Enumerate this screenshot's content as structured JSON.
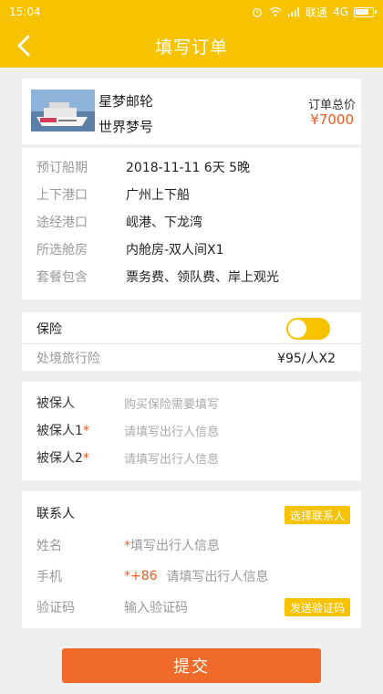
{
  "status_bar": {
    "time": "15:04",
    "carrier": "联通",
    "network": "4G"
  },
  "nav": {
    "title": "填写订单",
    "back_icon": "chevron-left-icon"
  },
  "product": {
    "name_line1": "星梦邮轮",
    "name_line2": "世界梦号",
    "total_label": "订单总价",
    "total_value": "¥7000"
  },
  "details": [
    {
      "label": "预订船期",
      "value": "2018-11-11  6天  5晚"
    },
    {
      "label": "上下港口",
      "value": "广州上下船"
    },
    {
      "label": "途经港口",
      "value": "岘港、下龙湾"
    },
    {
      "label": "所选舱房",
      "value": "内舱房-双人间X1"
    },
    {
      "label": "套餐包含",
      "value": "票务费、领队费、岸上观光"
    }
  ],
  "insurance": {
    "header": "保险",
    "toggle_on": true,
    "item": "处境旅行险",
    "price": "¥95/人X2"
  },
  "insured": {
    "header": "被保人",
    "header_hint": "购买保险需要填写",
    "persons": [
      {
        "label": "被保人1",
        "star": "*",
        "placeholder": "请填写出行人信息"
      },
      {
        "label": "被保人2",
        "star": "*",
        "placeholder": "请填写出行人信息"
      }
    ]
  },
  "contact": {
    "header": "联系人",
    "choose_button": "选择联系人",
    "name_label": "姓名",
    "name_star": "*",
    "name_placeholder": "填写出行人信息",
    "phone_label": "手机",
    "phone_prefix": "*+86",
    "phone_placeholder": "请填写出行人信息",
    "code_label": "验证码",
    "code_placeholder": "输入验证码",
    "send_code_button": "发送验证码"
  },
  "submit_label": "提交",
  "colors": {
    "brand": "#f7c300",
    "accent": "#ef5a20",
    "submit": "#f06a2a"
  }
}
